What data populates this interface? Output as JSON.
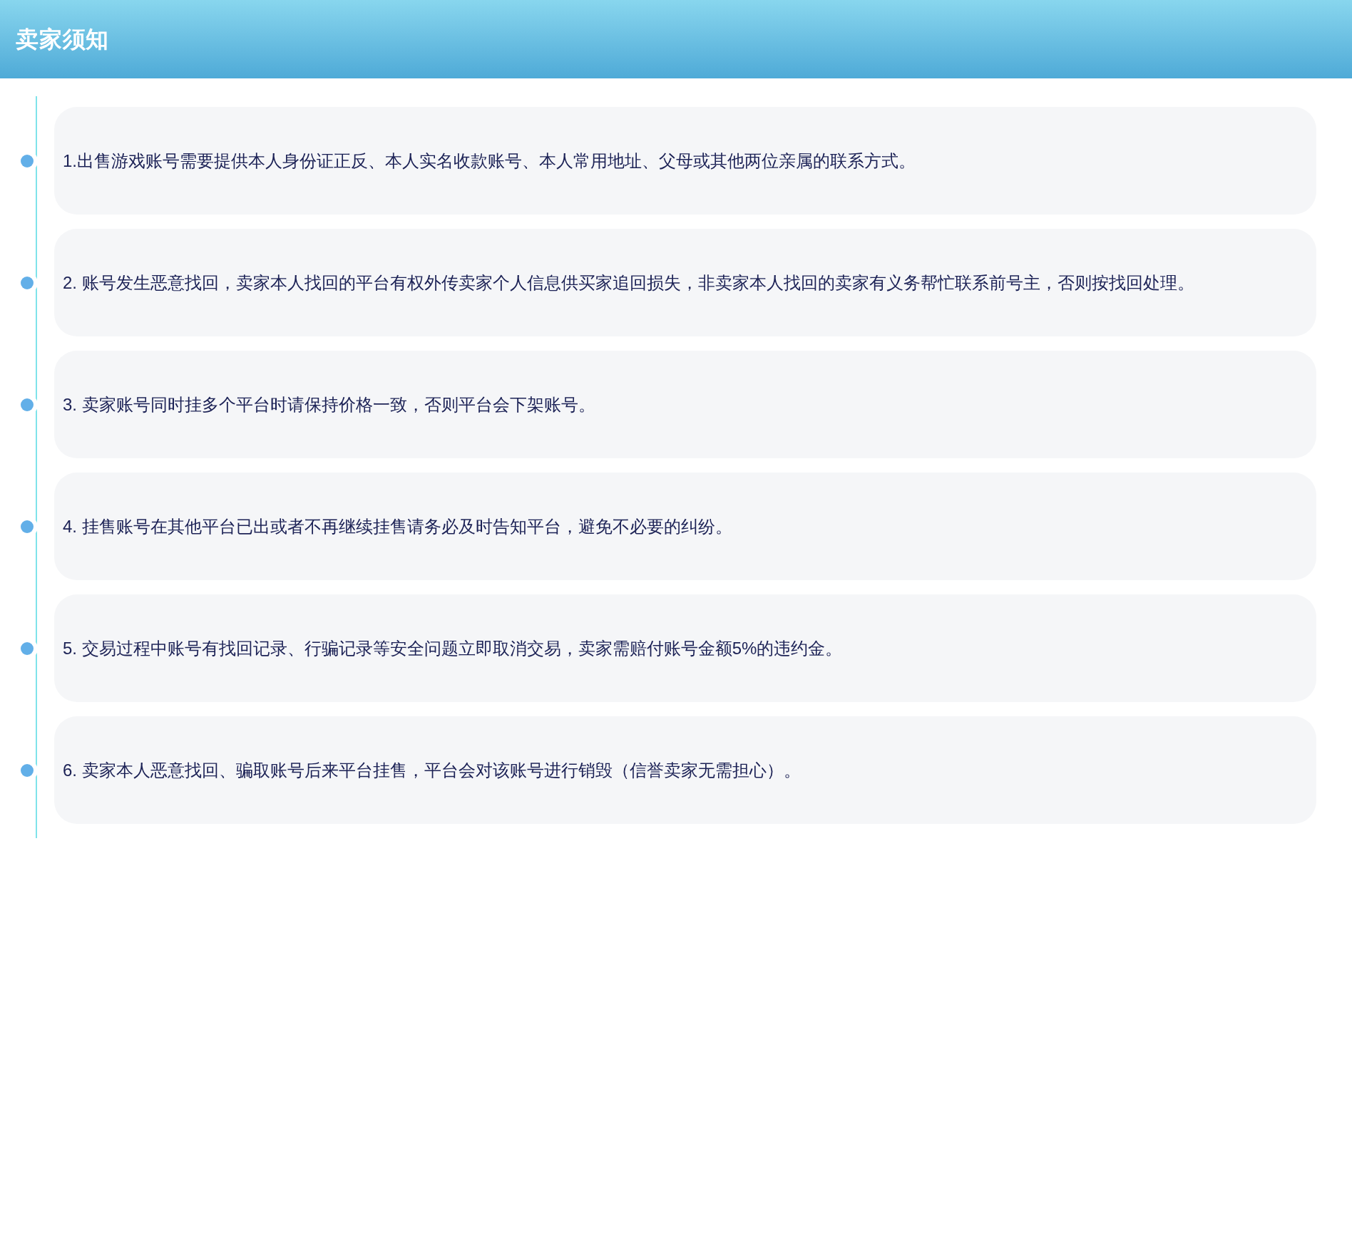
{
  "header": {
    "title": "卖家须知"
  },
  "notices": [
    {
      "text": "1.出售游戏账号需要提供本人身份证正反、本人实名收款账号、本人常用地址、父母或其他两位亲属的联系方式。"
    },
    {
      "text": "2. 账号发生恶意找回，卖家本人找回的平台有权外传卖家个人信息供买家追回损失，非卖家本人找回的卖家有义务帮忙联系前号主，否则按找回处理。"
    },
    {
      "text": "3. 卖家账号同时挂多个平台时请保持价格一致，否则平台会下架账号。"
    },
    {
      "text": "4. 挂售账号在其他平台已出或者不再继续挂售请务必及时告知平台，避免不必要的纠纷。"
    },
    {
      "text": "5. 交易过程中账号有找回记录、行骗记录等安全问题立即取消交易，卖家需赔付账号金额5%的违约金。"
    },
    {
      "text": "6. 卖家本人恶意找回、骗取账号后来平台挂售，平台会对该账号进行销毁（信誉卖家无需担心）。"
    }
  ]
}
